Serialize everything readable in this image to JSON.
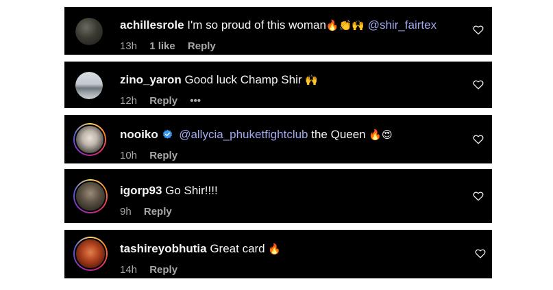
{
  "colors": {
    "background": "#000000",
    "text": "#f5f5f5",
    "meta": "#a8a8a8",
    "mention": "#a4a8f0",
    "verified": "#3897f0"
  },
  "comments": [
    {
      "username": "achillesrole",
      "text": "I'm so proud of this woman",
      "emojis": "🔥👏🙌",
      "mention": "@shir_fairtex",
      "time": "13h",
      "likes": "1 like",
      "reply": "Reply",
      "heart_icon": "heart-outline-icon"
    },
    {
      "username": "zino_yaron",
      "text": "Good luck Champ Shir",
      "emojis": "🙌",
      "time": "12h",
      "reply": "Reply",
      "more": "•••",
      "heart_icon": "heart-outline-icon"
    },
    {
      "username": "nooiko",
      "verified": true,
      "mention": "@allycia_phuketfightclub",
      "text": "the Queen",
      "emojis": "🔥😍",
      "time": "10h",
      "reply": "Reply",
      "heart_icon": "heart-outline-icon"
    },
    {
      "username": "igorp93",
      "text": "Go Shir!!!!",
      "time": "9h",
      "reply": "Reply",
      "heart_icon": "heart-outline-icon"
    },
    {
      "username": "tashireyobhutia",
      "text": "Great card",
      "emojis": "🔥",
      "time": "14h",
      "reply": "Reply",
      "heart_icon": "heart-outline-icon"
    }
  ]
}
